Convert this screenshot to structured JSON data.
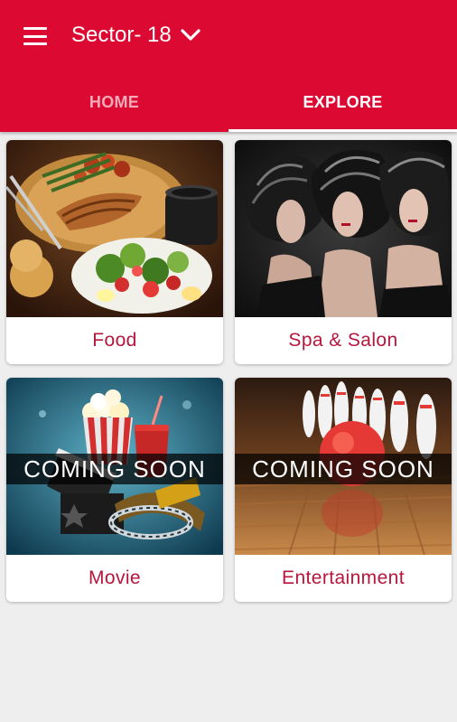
{
  "appbar": {
    "menu_icon": "hamburger-menu-icon",
    "location": "Sector- 18",
    "dropdown_icon": "chevron-down-icon"
  },
  "tabs": [
    {
      "label": "HOME",
      "active": false
    },
    {
      "label": "EXPLORE",
      "active": true
    }
  ],
  "categories": [
    {
      "label": "Food",
      "badge": ""
    },
    {
      "label": "Spa & Salon",
      "badge": ""
    },
    {
      "label": "Movie",
      "badge": "COMING SOON"
    },
    {
      "label": "Entertainment",
      "badge": "COMING SOON"
    }
  ],
  "colors": {
    "primary": "#dc0a32",
    "label_text": "#b6163b",
    "background": "#eeeeee"
  }
}
